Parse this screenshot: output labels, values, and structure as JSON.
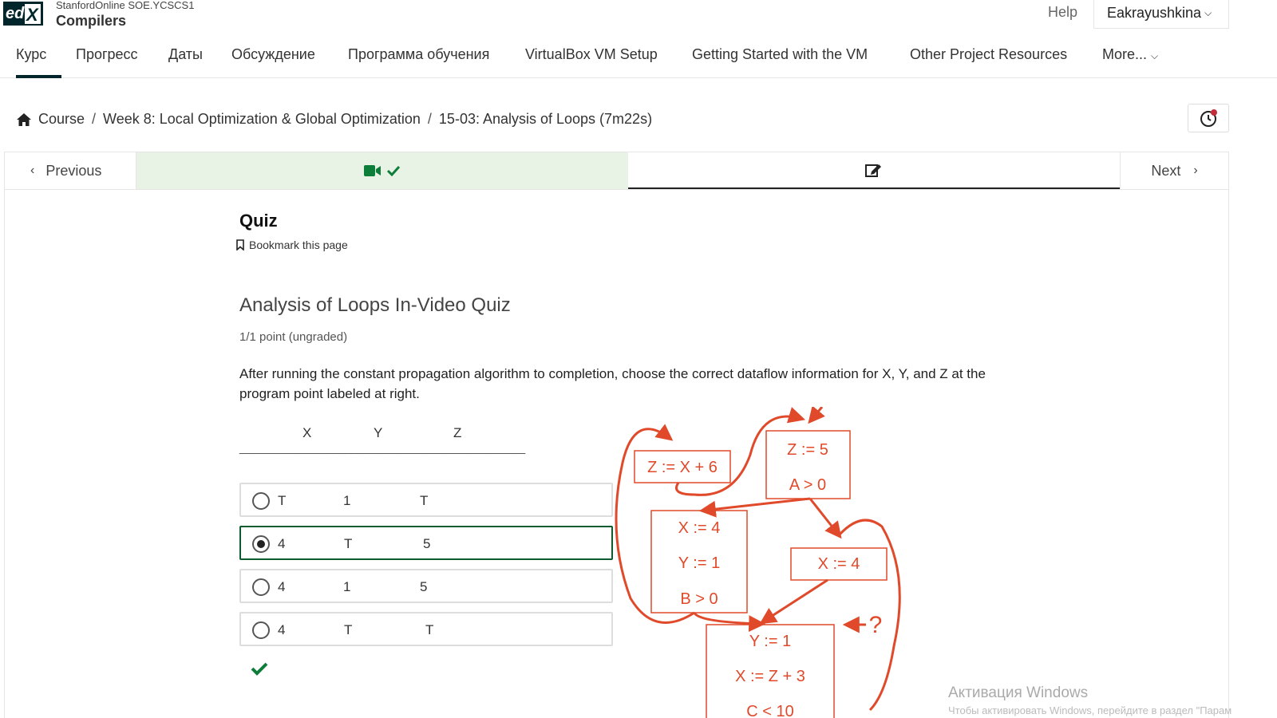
{
  "header": {
    "logo_text": "edX",
    "org": "StanfordOnline SOE.YCSCS1",
    "course": "Compilers",
    "help": "Help",
    "user": "Eakrayushkina"
  },
  "tabs": [
    {
      "label": "Курс"
    },
    {
      "label": "Прогресс"
    },
    {
      "label": "Даты"
    },
    {
      "label": "Обсуждение"
    },
    {
      "label": "Программа обучения"
    },
    {
      "label": "VirtualBox VM Setup"
    },
    {
      "label": "Getting Started with the VM"
    },
    {
      "label": "Other Project Resources"
    },
    {
      "label": "More..."
    }
  ],
  "breadcrumbs": [
    "Course",
    "Week 8: Local Optimization & Global Optimization",
    "15-03: Analysis of Loops (7m22s)"
  ],
  "sequence": {
    "previous": "Previous",
    "next": "Next"
  },
  "quiz": {
    "title": "Quiz",
    "bookmark": "Bookmark this page",
    "problem_title": "Analysis of Loops In-Video Quiz",
    "points": "1/1 point (ungraded)",
    "question": "After running the constant propagation algorithm to completion, choose the correct dataflow information for X, Y, and Z at the program point labeled at right.",
    "columns": [
      "X",
      "Y",
      "Z"
    ],
    "rule": "______________________________________________",
    "options": [
      {
        "x": "T",
        "y": "1",
        "z": "T",
        "selected": false
      },
      {
        "x": "4",
        "y": "T",
        "z": "5",
        "selected": true
      },
      {
        "x": "4",
        "y": "1",
        "z": "5",
        "selected": false
      },
      {
        "x": "4",
        "y": "T",
        "z": "T",
        "selected": false
      }
    ]
  },
  "diagram": {
    "boxes": {
      "b1": [
        "Z := X + 6"
      ],
      "b2": [
        "Z := 5",
        "A > 0"
      ],
      "b3": [
        "X := 4",
        "Y := 1",
        "B > 0"
      ],
      "b4": [
        "X := 4"
      ],
      "b5": [
        "Y := 1",
        "X := Z + 3",
        "C < 10"
      ]
    },
    "marker": "?",
    "color": "#e04a2a"
  },
  "watermark": {
    "line1": "Активация Windows",
    "line2": "Чтобы активировать Windows, перейдите в раздел \"Парам"
  },
  "colors": {
    "success_green": "#0d7d3a",
    "tab_underline": "#00262b",
    "selected_border": "#0d5c30"
  }
}
